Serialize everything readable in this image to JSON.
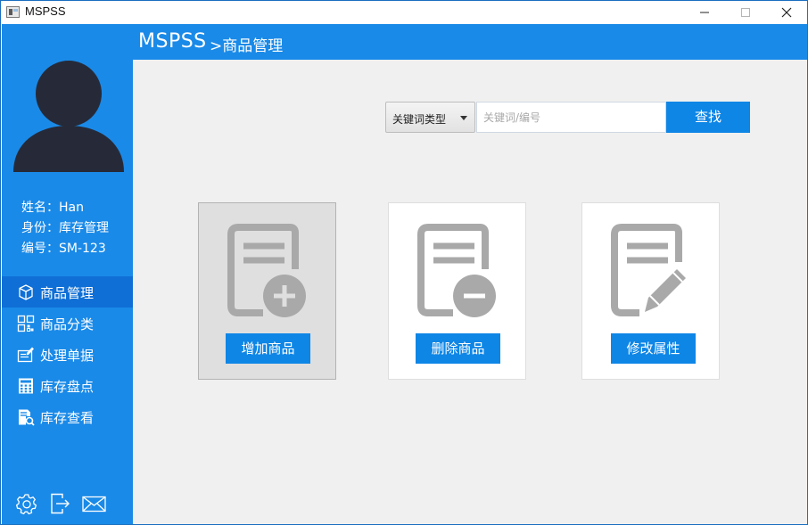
{
  "window": {
    "title": "MSPSS"
  },
  "header": {
    "brand": "MSPSS",
    "breadcrumb": ">商品管理"
  },
  "user": {
    "name": "姓名：Han",
    "role": "身份：库存管理",
    "id": "编号：SM-123"
  },
  "sidebar": {
    "items": [
      {
        "label": "商品管理",
        "icon": "box-icon",
        "active": true
      },
      {
        "label": "商品分类",
        "icon": "grid-icon",
        "active": false
      },
      {
        "label": "处理单据",
        "icon": "edit-document-icon",
        "active": false
      },
      {
        "label": "库存盘点",
        "icon": "calculator-icon",
        "active": false
      },
      {
        "label": "库存查看",
        "icon": "document-search-icon",
        "active": false
      }
    ],
    "bottom_icons": [
      "gear-icon",
      "logout-icon",
      "mail-icon"
    ]
  },
  "search": {
    "type_selected": "关键词类型",
    "placeholder": "关键词/编号",
    "value": "",
    "button_label": "查找"
  },
  "actions": [
    {
      "label": "增加商品",
      "icon": "document-add-icon",
      "selected": true
    },
    {
      "label": "删除商品",
      "icon": "document-remove-icon",
      "selected": false
    },
    {
      "label": "修改属性",
      "icon": "document-edit-icon",
      "selected": false
    }
  ],
  "colors": {
    "primary": "#1a8ae8",
    "nav_active": "#0f6fd6",
    "button": "#0e86e6",
    "avatar": "#262a38",
    "doc_icon": "#a9a9a9"
  }
}
